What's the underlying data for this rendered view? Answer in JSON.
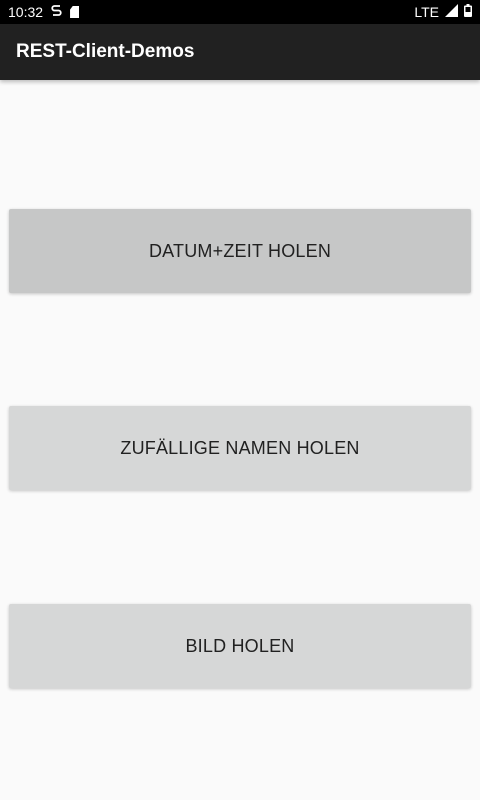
{
  "status_bar": {
    "time": "10:32",
    "network": "LTE",
    "left_icons": [
      "sync-icon",
      "sd-card-icon"
    ],
    "right_icons": [
      "signal-icon",
      "battery-icon"
    ]
  },
  "app_bar": {
    "title": "REST-Client-Demos"
  },
  "buttons": [
    {
      "label": "DATUM+ZEIT HOLEN"
    },
    {
      "label": "ZUFÄLLIGE NAMEN HOLEN"
    },
    {
      "label": "BILD HOLEN"
    }
  ],
  "colors": {
    "status_bar": "#000000",
    "app_bar": "#212121",
    "background": "#fafafa",
    "button": "#d6d7d7",
    "button_pressed": "#c6c7c7"
  }
}
